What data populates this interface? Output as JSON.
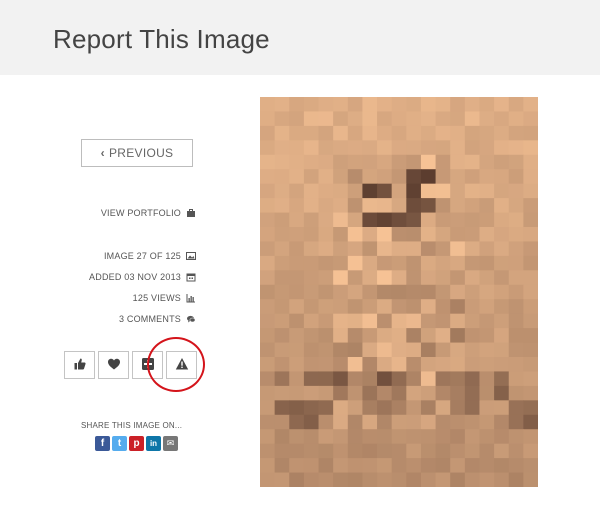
{
  "page": {
    "title": "Report This Image"
  },
  "nav": {
    "previous_label": "PREVIOUS"
  },
  "meta": {
    "view_portfolio": "VIEW PORTFOLIO",
    "image_count": "IMAGE 27 OF 125",
    "added": "ADDED 03 NOV 2013",
    "views": "125 VIEWS",
    "comments": "3 COMMENTS"
  },
  "actions": [
    {
      "name": "like",
      "icon": "thumbs-up-icon"
    },
    {
      "name": "favorite",
      "icon": "heart-icon"
    },
    {
      "name": "add",
      "icon": "plus-square-icon"
    },
    {
      "name": "report",
      "icon": "warning-icon",
      "highlighted": true
    }
  ],
  "share": {
    "label": "SHARE THIS IMAGE ON...",
    "networks": [
      {
        "name": "facebook",
        "glyph": "f",
        "color": "#3b5998"
      },
      {
        "name": "twitter",
        "glyph": "t",
        "color": "#55acee"
      },
      {
        "name": "pinterest",
        "glyph": "p",
        "color": "#cb2027"
      },
      {
        "name": "linkedin",
        "glyph": "in",
        "color": "#0e76a8"
      },
      {
        "name": "email",
        "glyph": "✉",
        "color": "#777777"
      }
    ]
  },
  "colors": {
    "highlight": "#d4141b",
    "header_bg": "#f2f2f2"
  }
}
